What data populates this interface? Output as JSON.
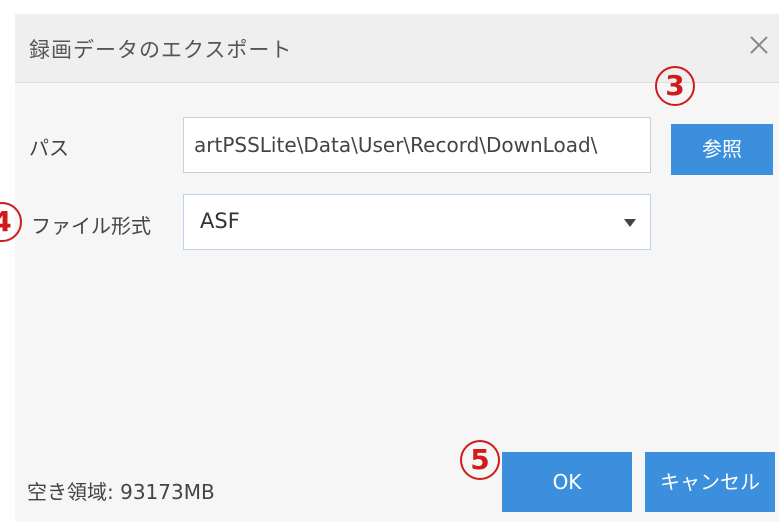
{
  "dialog": {
    "title": "録画データのエクスポート",
    "close_icon": "close-icon"
  },
  "path": {
    "label": "パス",
    "value": "artPSSLite\\Data\\User\\Record\\DownLoad\\",
    "browse_label": "参照"
  },
  "format": {
    "label": "ファイル形式",
    "selected": "ASF",
    "dropdown_icon": "caret-down-icon"
  },
  "footer": {
    "free_space": "空き領域: 93173MB",
    "ok_label": "OK",
    "cancel_label": "キャンセル"
  },
  "annotations": {
    "marker_3": "3",
    "marker_4": "4",
    "marker_5": "5",
    "color": "#d11a1a"
  },
  "colors": {
    "accent": "#3b8fdc",
    "dialog_bg": "#f6f6f6",
    "titlebar_bg": "#efefef"
  }
}
